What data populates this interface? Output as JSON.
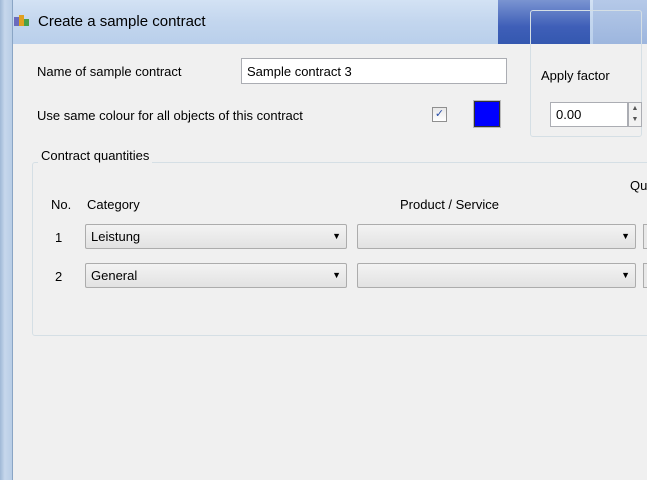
{
  "window": {
    "title": "Create a sample contract"
  },
  "form": {
    "name_label": "Name of sample contract",
    "name_value": "Sample contract 3",
    "same_colour_label": "Use same colour for all objects of this contract",
    "same_colour_checked": true,
    "check_glyph": "✓",
    "colour_value": "#0000ff"
  },
  "apply_factor": {
    "legend": "Apply factor",
    "value": "0.00"
  },
  "quantities": {
    "legend": "Contract quantities",
    "columns": {
      "no": "No.",
      "category": "Category",
      "product": "Product / Service",
      "quantity_partial": "Qu"
    },
    "rows": [
      {
        "no": "1",
        "category": "Leistung",
        "product": ""
      },
      {
        "no": "2",
        "category": "General",
        "product": ""
      }
    ]
  },
  "glyphs": {
    "dropdown_arrow": "▼",
    "spin_up": "▲",
    "spin_down": "▼"
  }
}
